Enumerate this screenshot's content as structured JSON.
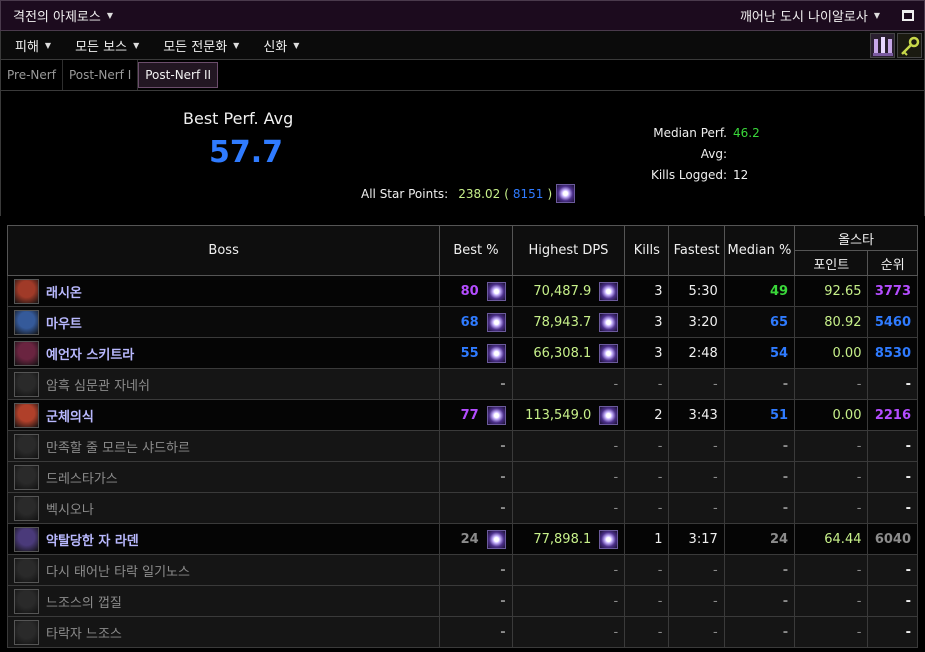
{
  "topbar": {
    "zone": "격전의 아제로스",
    "region": "깨어난 도시 나이알로사"
  },
  "menu": {
    "items": [
      "피해",
      "모든 보스",
      "모든 전문화",
      "신화"
    ]
  },
  "tabs": [
    "Pre-Nerf",
    "Post-Nerf I",
    "Post-Nerf II"
  ],
  "summary": {
    "best_label": "Best Perf. Avg",
    "best_value": "57.7",
    "median_label": "Median Perf. Avg:",
    "median_value": "46.2",
    "kills_label": "Kills Logged:",
    "kills_value": "12",
    "star_label": "All Star Points:",
    "star_value": "238.02",
    "star_rank": "8151"
  },
  "table": {
    "headers": {
      "boss": "Boss",
      "best": "Best %",
      "dps": "Highest DPS",
      "kills": "Kills",
      "fastest": "Fastest",
      "median": "Median %",
      "allstar": "올스타",
      "points": "포인트",
      "rank": "순위"
    },
    "rows": [
      {
        "name": "래시온",
        "best": "80",
        "best_color": "#b44dff",
        "dps": "70,487.9",
        "kills": "3",
        "fastest": "5:30",
        "median": "49",
        "median_color": "#3ad83a",
        "points": "92.65",
        "rank": "3773",
        "rank_color": "#b44dff",
        "active": true,
        "icon_color": "#a03a28"
      },
      {
        "name": "마우트",
        "best": "68",
        "best_color": "#2f7bff",
        "dps": "78,943.7",
        "kills": "3",
        "fastest": "3:20",
        "median": "65",
        "median_color": "#2f7bff",
        "points": "80.92",
        "rank": "5460",
        "rank_color": "#2f7bff",
        "active": true,
        "icon_color": "#355a9a"
      },
      {
        "name": "예언자 스키트라",
        "best": "55",
        "best_color": "#2f7bff",
        "dps": "66,308.1",
        "kills": "3",
        "fastest": "2:48",
        "median": "54",
        "median_color": "#2f7bff",
        "points": "0.00",
        "rank": "8530",
        "rank_color": "#2f7bff",
        "active": true,
        "icon_color": "#6a2440"
      },
      {
        "name": "암흑 심문관 자네쉬",
        "best": "-",
        "dps": "-",
        "kills": "-",
        "fastest": "-",
        "median": "-",
        "points": "-",
        "rank": "-",
        "active": false,
        "icon_color": "#2a2a2a"
      },
      {
        "name": "군체의식",
        "best": "77",
        "best_color": "#b44dff",
        "dps": "113,549.0",
        "kills": "2",
        "fastest": "3:43",
        "median": "51",
        "median_color": "#2f7bff",
        "points": "0.00",
        "rank": "2216",
        "rank_color": "#b44dff",
        "active": true,
        "icon_color": "#b0402a"
      },
      {
        "name": "만족할 줄 모르는 샤드하르",
        "best": "-",
        "dps": "-",
        "kills": "-",
        "fastest": "-",
        "median": "-",
        "points": "-",
        "rank": "-",
        "active": false,
        "icon_color": "#2a2a2a"
      },
      {
        "name": "드레스타가스",
        "best": "-",
        "dps": "-",
        "kills": "-",
        "fastest": "-",
        "median": "-",
        "points": "-",
        "rank": "-",
        "active": false,
        "icon_color": "#2a2a2a"
      },
      {
        "name": "벡시오나",
        "best": "-",
        "dps": "-",
        "kills": "-",
        "fastest": "-",
        "median": "-",
        "points": "-",
        "rank": "-",
        "active": false,
        "icon_color": "#2a2a2a"
      },
      {
        "name": "약탈당한 자 라덴",
        "best": "24",
        "best_color": "#8c8c8c",
        "dps": "77,898.1",
        "kills": "1",
        "fastest": "3:17",
        "median": "24",
        "median_color": "#8c8c8c",
        "points": "64.44",
        "rank": "6040",
        "rank_color": "#8c8c8c",
        "active": true,
        "icon_color": "#4a3a7a"
      },
      {
        "name": "다시 태어난 타락 일기노스",
        "best": "-",
        "dps": "-",
        "kills": "-",
        "fastest": "-",
        "median": "-",
        "points": "-",
        "rank": "-",
        "active": false,
        "icon_color": "#2a2a2a"
      },
      {
        "name": "느조스의 껍질",
        "best": "-",
        "dps": "-",
        "kills": "-",
        "fastest": "-",
        "median": "-",
        "points": "-",
        "rank": "-",
        "active": false,
        "icon_color": "#2a2a2a"
      },
      {
        "name": "타락자 느조스",
        "best": "-",
        "dps": "-",
        "kills": "-",
        "fastest": "-",
        "median": "-",
        "points": "-",
        "rank": "-",
        "active": false,
        "icon_color": "#2a2a2a"
      }
    ]
  },
  "icons": {
    "raid_icon": "raid-banner-icon",
    "key_icon": "key-icon",
    "spark_icon": "spark-log-icon"
  },
  "colors": {
    "accent_blue": "#2f7bff",
    "purple": "#b44dff",
    "green": "#3ad83a",
    "lime": "#c7f08a",
    "gray": "#8c8c8c"
  }
}
